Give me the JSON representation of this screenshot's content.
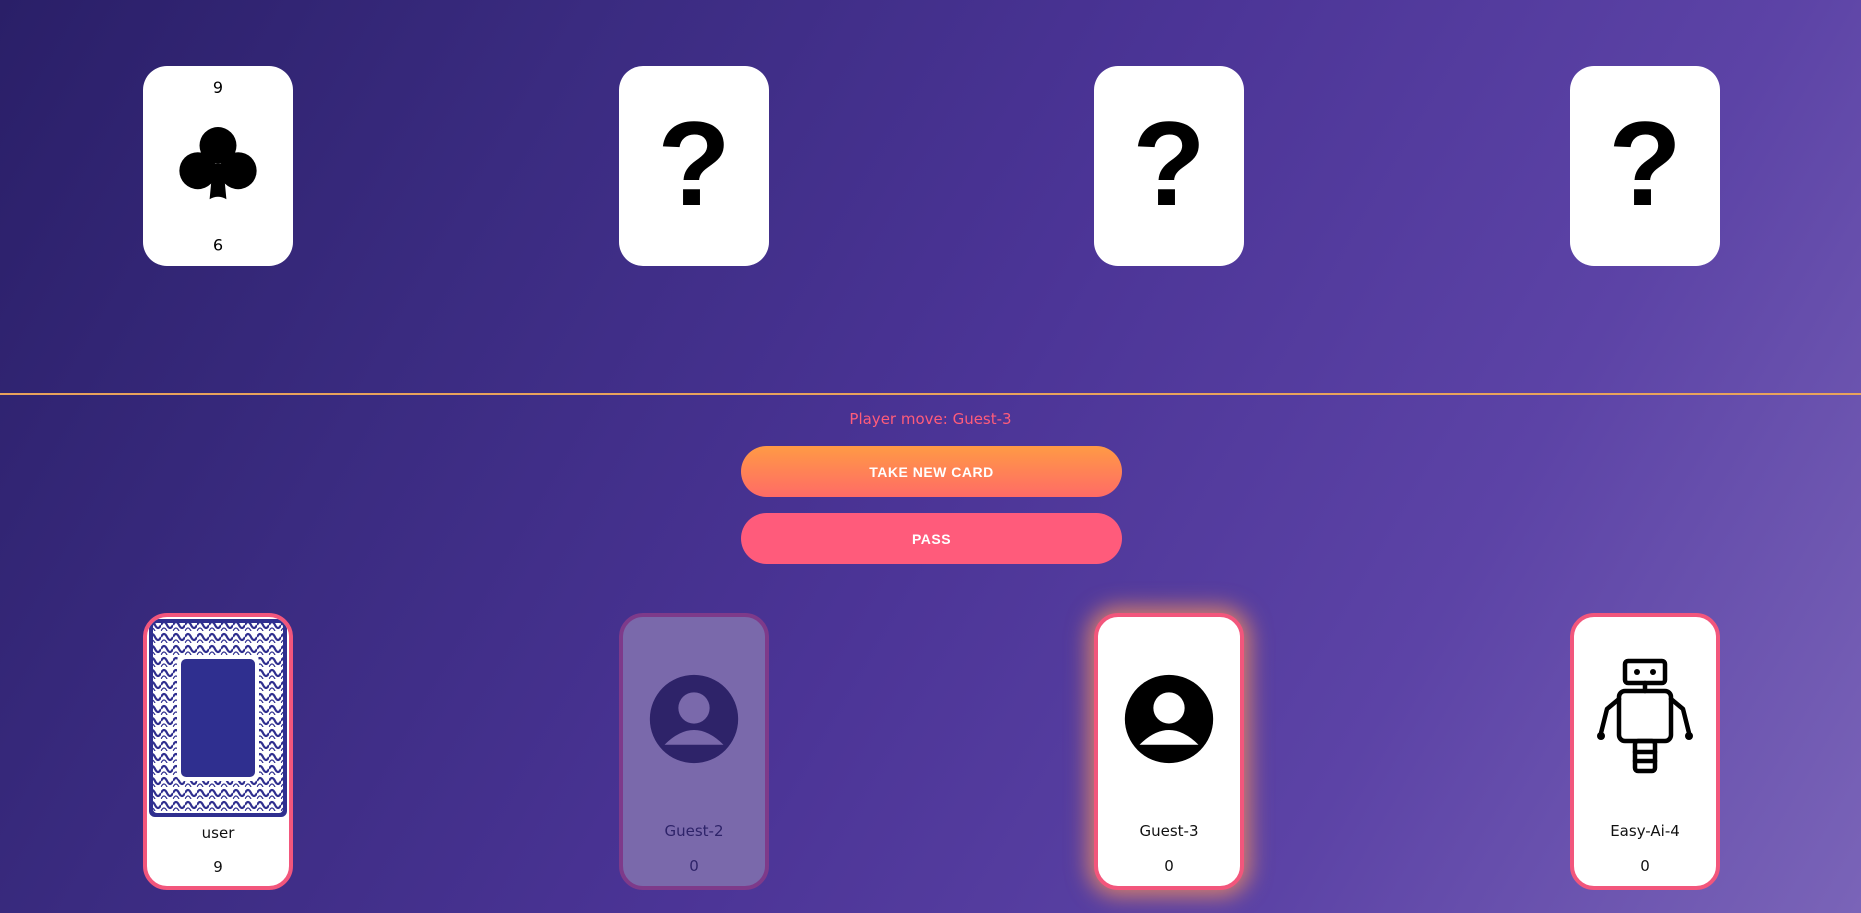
{
  "table": {
    "cards": [
      {
        "rank": "9",
        "suit": "clubs",
        "face_up": true
      },
      {
        "face_up": false,
        "label": "?"
      },
      {
        "face_up": false,
        "label": "?"
      },
      {
        "face_up": false,
        "label": "?"
      }
    ]
  },
  "status": {
    "player_move": "Player move: Guest-3"
  },
  "actions": {
    "take_label": "TAKE NEW CARD",
    "pass_label": "PASS"
  },
  "players": [
    {
      "name": "user",
      "score": "9",
      "avatar": "card-back-icon",
      "state": "normal"
    },
    {
      "name": "Guest-2",
      "score": "0",
      "avatar": "person-icon",
      "state": "inactive"
    },
    {
      "name": "Guest-3",
      "score": "0",
      "avatar": "person-icon",
      "state": "active"
    },
    {
      "name": "Easy-Ai-4",
      "score": "0",
      "avatar": "robot-icon",
      "state": "normal"
    }
  ],
  "colors": {
    "accent": "#ff5c7a",
    "divider": "#e8a25c",
    "take_button": "#ff8a50",
    "pass_button": "#ff5b7b",
    "card_back": "#2f2f8f"
  }
}
